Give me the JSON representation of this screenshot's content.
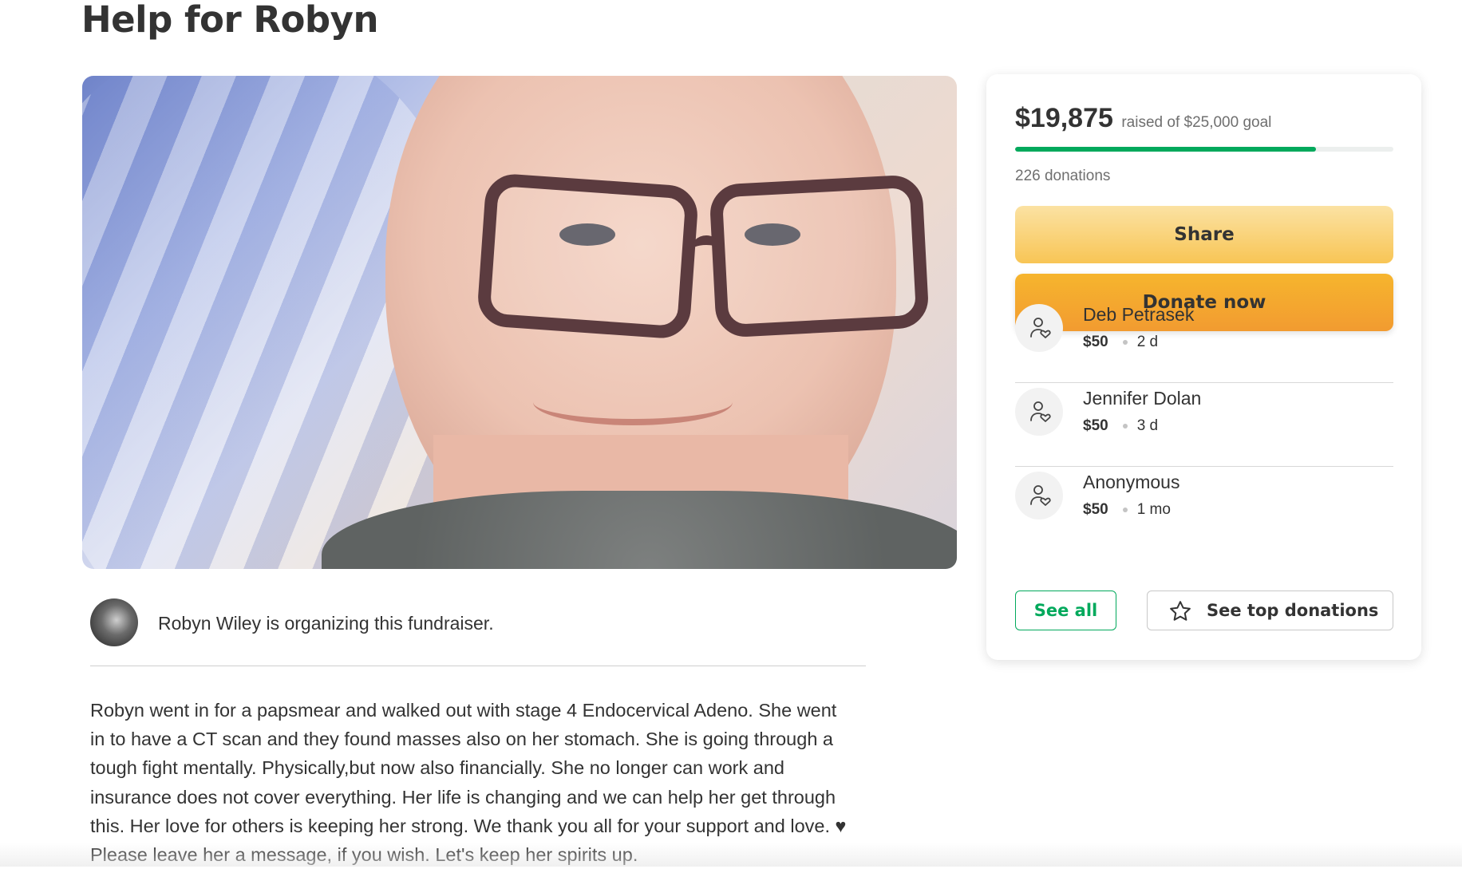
{
  "page": {
    "title": "Help for Robyn"
  },
  "organizer": {
    "text": "Robyn Wiley is organizing this fundraiser."
  },
  "story": {
    "text": "Robyn went in for a papsmear and walked out with stage 4 Endocervical Adeno.  She went\nin to have a CT scan and they found masses also on her stomach.  She is going through a\ntough fight mentally. Physically,but now also financially.  She no longer can work and\ninsurance does not cover everything. Her life is changing and we can help her get through\nthis.  Her love for others is keeping her strong.  We thank you all for your support and love. ♥\nPlease leave her a message, if you wish.  Let's keep her spirits up."
  },
  "donation_card": {
    "amount_raised": "$19,875",
    "goal_text": "raised of $25,000 goal",
    "progress_fraction": 0.795,
    "donations_count": "226 donations",
    "share_label": "Share",
    "donate_label": "Donate now",
    "donors": [
      {
        "name": "Deb Petrasek",
        "amount": "$50",
        "time": "2 d"
      },
      {
        "name": "Jennifer Dolan",
        "amount": "$50",
        "time": "3 d"
      },
      {
        "name": "Anonymous",
        "amount": "$50",
        "time": "1 mo"
      }
    ],
    "see_all_label": "See all",
    "see_top_label": "See top donations"
  },
  "colors": {
    "progress": "#02a95c",
    "share_button": "#f8c555",
    "donate_button": "#f29b30",
    "see_all": "#02a95c"
  },
  "icons": [
    "donor-heart-icon",
    "star-icon"
  ]
}
